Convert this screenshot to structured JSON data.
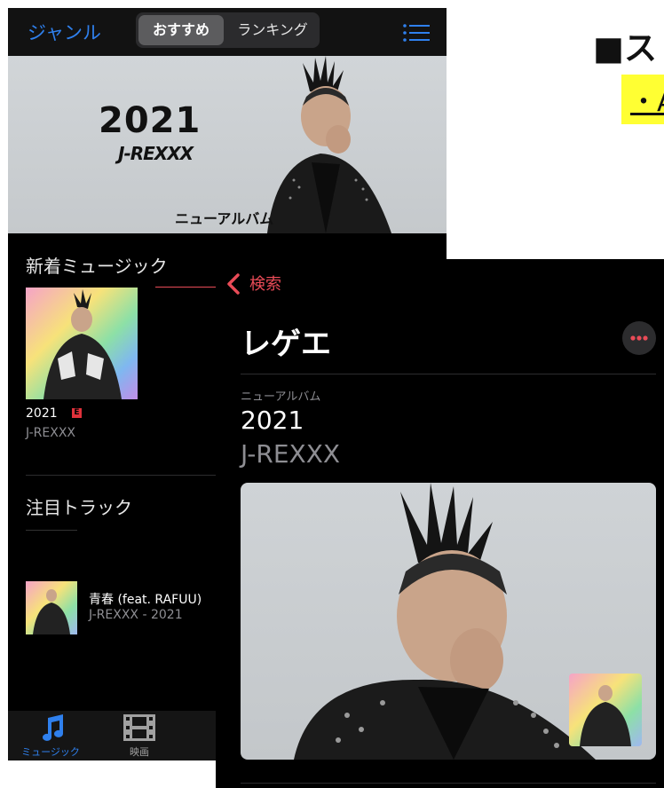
{
  "doc": {
    "heading": "■ス",
    "link_text": "・A"
  },
  "screen1": {
    "nav": {
      "genre_label": "ジャンル",
      "segment_selected": "おすすめ",
      "segment_other": "ランキング",
      "list_icon": "list-icon"
    },
    "banner": {
      "year": "2021",
      "logo": "J-REXXX",
      "subtitle": "ニューアルバム"
    },
    "new_music": {
      "title": "新着ミュージック",
      "album_title": "2021",
      "explicit_badge": "E",
      "artist": "J-REXXX"
    },
    "featured": {
      "title": "注目トラック",
      "track_title": "青春 (feat. RAFUU)",
      "track_sub": "J-REXXX - 2021"
    },
    "tabs": [
      {
        "label": "ミュージック",
        "icon": "music-note-icon",
        "color": "#2f80ed"
      },
      {
        "label": "映画",
        "icon": "film-icon",
        "color": "#a0a0a0"
      }
    ]
  },
  "screen2": {
    "back_label": "検索",
    "page_title": "レゲエ",
    "kicker": "ニューアルバム",
    "album_title": "2021",
    "artist": "J-REXXX",
    "more_icon": "ellipsis-icon"
  },
  "colors": {
    "ios_blue": "#2f80ed",
    "accent_red": "#e94b57",
    "secondary_text": "#8e8e93",
    "highlight_yellow": "#ffff33"
  }
}
